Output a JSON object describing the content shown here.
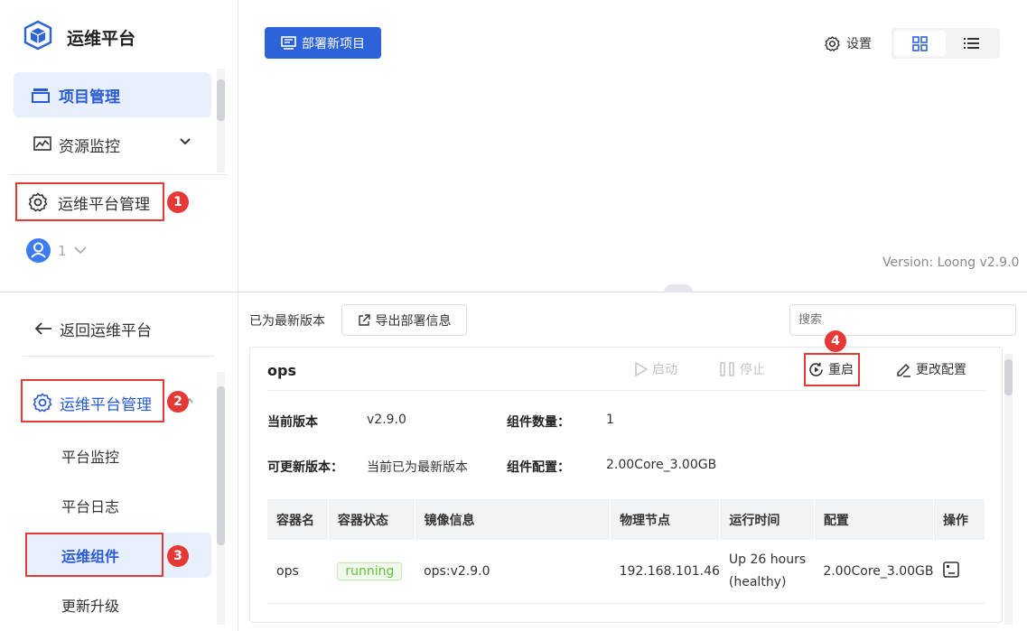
{
  "top": {
    "app_title": "运维平台",
    "nav": {
      "project_mgmt": "项目管理",
      "resource_monitor": "资源监控",
      "ops_platform_mgmt": "运维平台管理"
    },
    "user": {
      "name": "1"
    },
    "toolbar": {
      "deploy_button": "部署新项目",
      "settings": "设置"
    },
    "version": "Version: Loong v2.9.0"
  },
  "bottom": {
    "sidebar": {
      "back": "返回运维平台",
      "group": "运维平台管理",
      "items": [
        "平台监控",
        "平台日志",
        "运维组件",
        "更新升级"
      ]
    },
    "header": {
      "latest_text": "已为最新版本",
      "export_button": "导出部署信息",
      "search_placeholder": "搜索"
    },
    "card": {
      "name": "ops",
      "actions": {
        "start": "启动",
        "stop": "停止",
        "restart": "重启",
        "config": "更改配置"
      },
      "info": {
        "current_version_label": "当前版本",
        "current_version": "v2.9.0",
        "component_count_label": "组件数量：",
        "component_count": "1",
        "updatable_label": "可更新版本：",
        "updatable": "当前已为最新版本",
        "component_config_label": "组件配置：",
        "component_config": "2.00Core_3.00GB"
      },
      "table": {
        "headers": [
          "容器名",
          "容器状态",
          "镜像信息",
          "物理节点",
          "运行时间",
          "配置",
          "操作"
        ],
        "rows": [
          {
            "name": "ops",
            "status": "running",
            "image": "ops:v2.9.0",
            "node": "192.168.101.46",
            "uptime_1": "Up 26 hours",
            "uptime_2": "(healthy)",
            "config": "2.00Core_3.00GB"
          }
        ]
      }
    }
  },
  "annotations": [
    "1",
    "2",
    "3",
    "4"
  ],
  "colors": {
    "accent": "#2d63d8",
    "annotation_red": "#e53935",
    "running_green": "#67c23a"
  }
}
